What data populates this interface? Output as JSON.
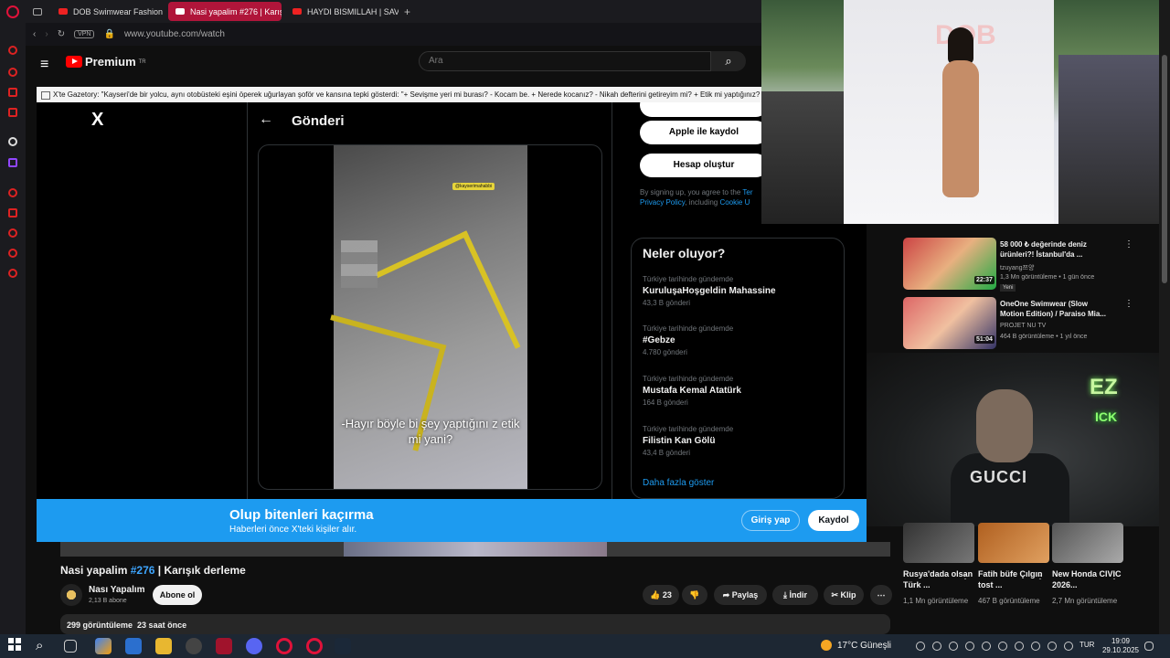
{
  "browser": {
    "tabs": [
      {
        "label": "DOB Swimwear Fashion S"
      },
      {
        "label": "Nasi yapalim #276 | Karış"
      },
      {
        "label": "HAYDI BISMILLAH | SAVV"
      }
    ],
    "new_tab": "+",
    "vpn": "VPN",
    "url": "www.youtube.com/watch"
  },
  "youtube": {
    "brand": "Premium",
    "region": "TR",
    "search_placeholder": "Ara"
  },
  "ticker": "X'te Gazetory: \"Kayseri'de bir yolcu, aynı otobüsteki eşini öperek uğurlayan şoför ve kansına tepki gösterdi: \"+ Sevişme yeri mi burası? - Kocam be. + Nerede kocanız? - Nikah defterini getireyim mi? + Etik mi yaptığınız? - Ya",
  "xpage": {
    "logo": "X",
    "back": "←",
    "title": "Gönderi",
    "video_watermark": "@kayserimahabbi",
    "video_caption": "-Hayır böyle bi şey yaptığını z etik mi yani?",
    "apple_btn": "Apple ile kaydol",
    "create_btn": "Hesap oluştur",
    "legal_prefix": "By signing up, you agree to the ",
    "legal_terms": "Ter",
    "legal_privacy": "Privacy Policy",
    "legal_including": ", including ",
    "legal_cookie": "Cookie U",
    "trends_title": "Neler oluyor?",
    "trends": [
      {
        "context": "Türkiye tarihinde gündemde",
        "name": "KuruluşaHoşgeldin Mahassine",
        "count": "43,3 B gönderi"
      },
      {
        "context": "Türkiye tarihinde gündemde",
        "name": "#Gebze",
        "count": "4.780 gönderi"
      },
      {
        "context": "Türkiye tarihinde gündemde",
        "name": "Mustafa Kemal Atatürk",
        "count": "164 B gönderi"
      },
      {
        "context": "Türkiye tarihinde gündemde",
        "name": "Filistin Kan Gölü",
        "count": "43,4 B gönderi"
      }
    ],
    "show_more": "Daha fazla göster"
  },
  "xbanner": {
    "title": "Olup bitenleri kaçırma",
    "subtitle": "Haberleri önce X'teki kişiler alır.",
    "login": "Giriş yap",
    "signup": "Kaydol"
  },
  "video": {
    "title_prefix": "Nasi yapalim ",
    "title_tag": "#276",
    "title_suffix": " | Karışık derleme",
    "channel": "Nası Yapalım",
    "subscribers": "2,13 B abone",
    "subscribe": "Abone ol",
    "likes": "23",
    "share": "Paylaş",
    "download": "İndir",
    "clip": "Klip",
    "views": "299 görüntüleme",
    "age": "23 saat önce"
  },
  "runway_brand": "DOB",
  "recommendations": [
    {
      "title": "58 000 ₺ değerinde deniz ürünleri?! İstanbul'da ...",
      "channel": "tzuyang쯔양",
      "meta": "1,3 Mn görüntüleme • 1 gün önce",
      "badge": "Yeni",
      "duration": "22:37"
    },
    {
      "title": "OneOne Swimwear (Slow Motion Edition) / Paraiso Mia...",
      "channel": "PROJET NU TV",
      "meta": "464 B görüntüleme • 1 yıl önce",
      "badge": "",
      "duration": "51:04"
    }
  ],
  "webcam": {
    "shirt_logo": "GUCCI",
    "neon": "EZ",
    "neon2": "ICK"
  },
  "shorts": [
    {
      "title": "Rusya'dada olsan Türk ...",
      "views": "1,1 Mn görüntüleme"
    },
    {
      "title": "Fatih büfe Çılgın tost ...",
      "views": "467 B görüntüleme"
    },
    {
      "title": "New Honda CIVIC 2026...",
      "views": "2,7 Mn görüntüleme"
    }
  ],
  "taskbar": {
    "weather": "17°C  Güneşli",
    "lang": "TUR",
    "time": "19:09",
    "date": "29.10.2025"
  },
  "colors": {
    "x_blue": "#1d9bf0",
    "yt_red": "#ff0000",
    "opera_red": "#e0123a"
  }
}
